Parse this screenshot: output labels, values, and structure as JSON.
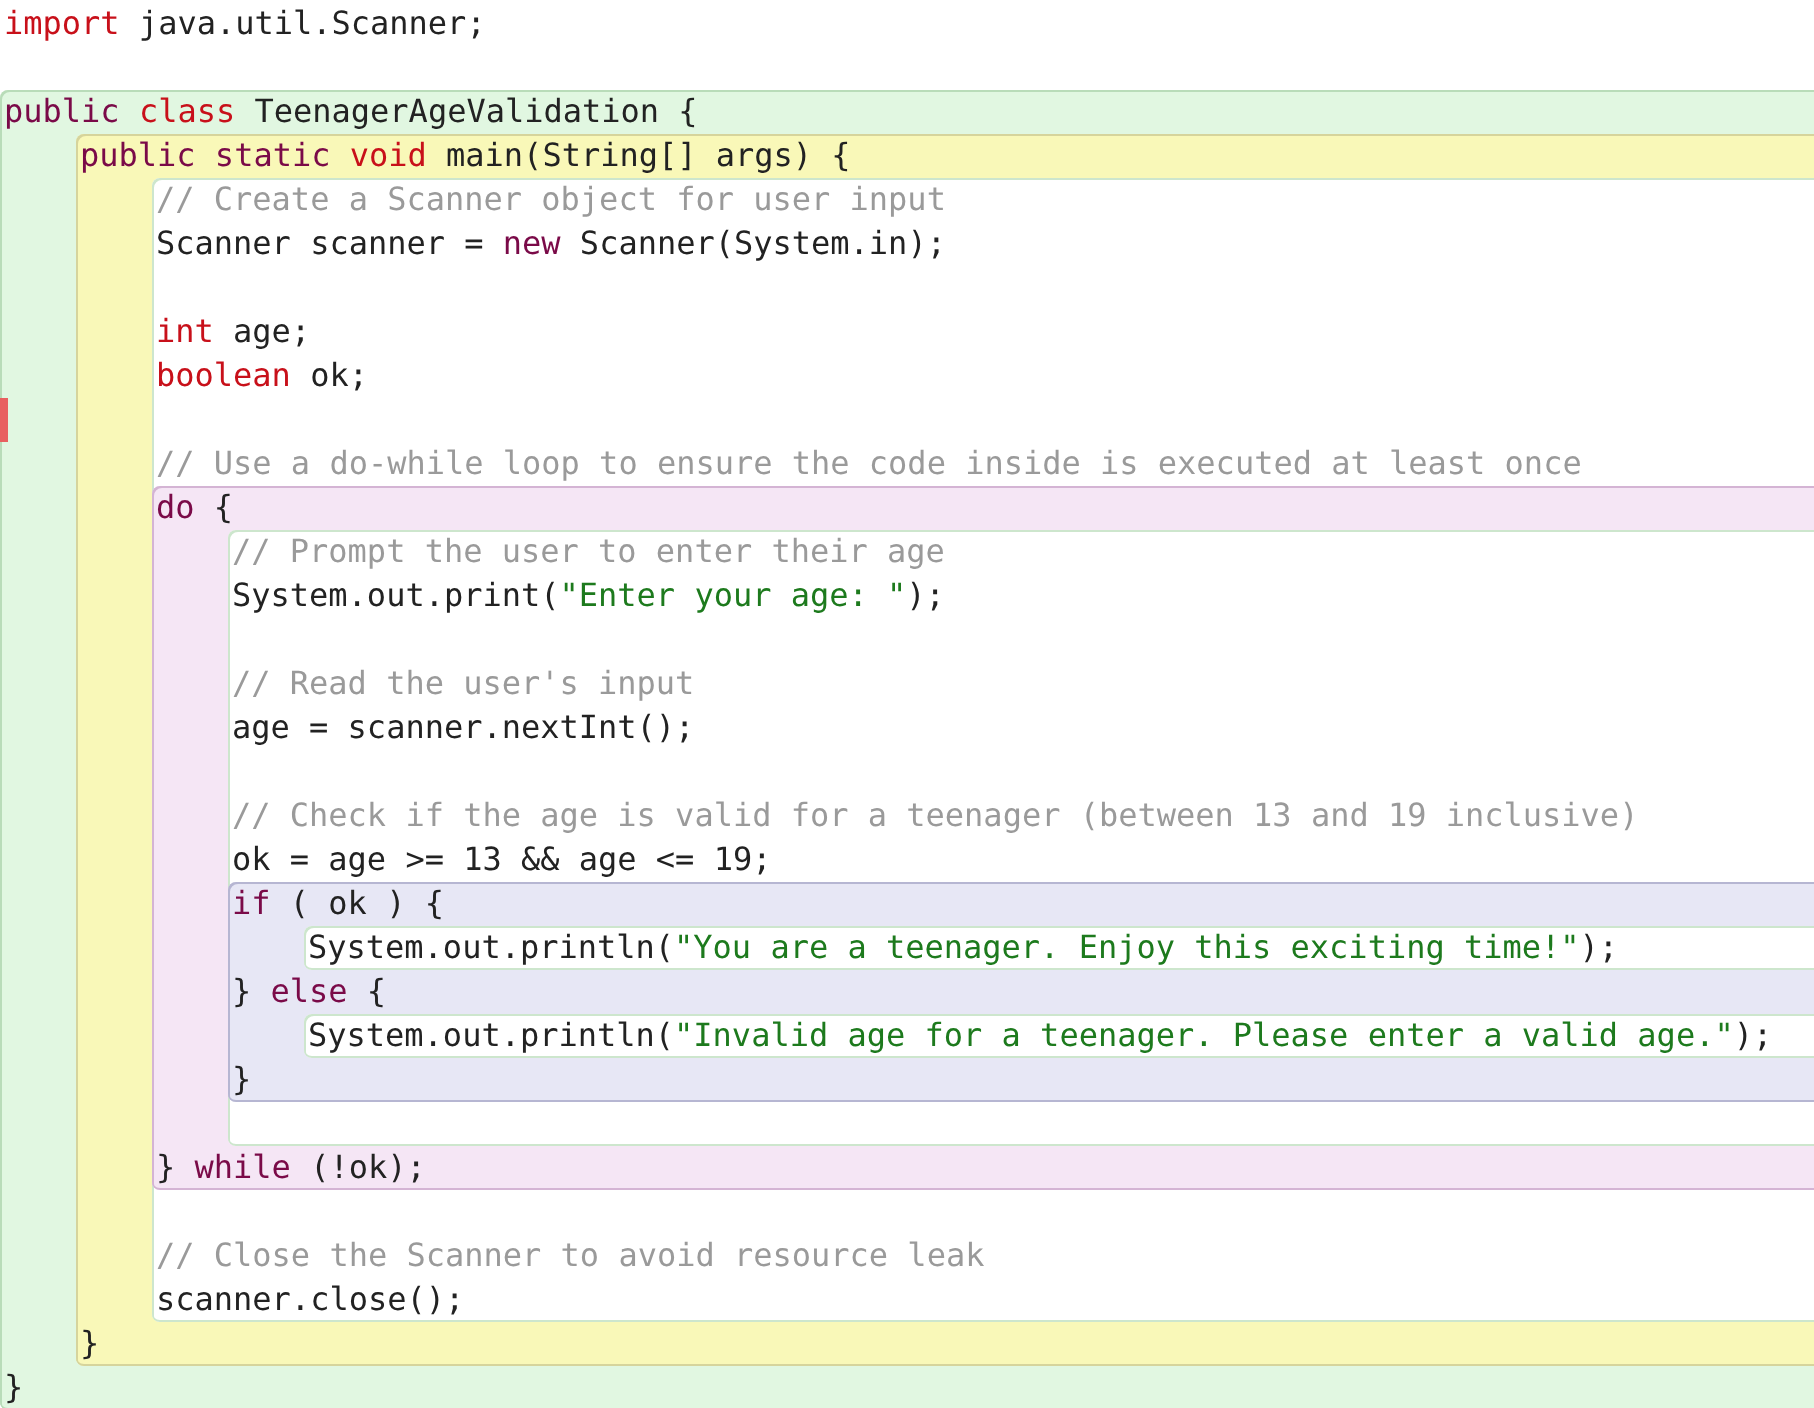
{
  "editor": {
    "items": [
      {
        "kind": "line",
        "tokens": [
          {
            "kind": "type",
            "text": "import"
          },
          {
            "kind": "plain",
            "text": " java.util.Scanner;"
          }
        ]
      },
      {
        "kind": "blank"
      },
      {
        "kind": "class",
        "items": [
          {
            "kind": "line",
            "tokens": [
              {
                "kind": "kw",
                "text": "public "
              },
              {
                "kind": "type",
                "text": "class"
              },
              {
                "kind": "plain",
                "text": " TeenagerAgeValidation {"
              }
            ]
          },
          {
            "kind": "method",
            "items": [
              {
                "kind": "line",
                "tokens": [
                  {
                    "kind": "kw",
                    "text": "public static "
                  },
                  {
                    "kind": "type",
                    "text": "void"
                  },
                  {
                    "kind": "plain",
                    "text": " main(String[] args) {"
                  }
                ]
              },
              {
                "kind": "body",
                "items": [
                  {
                    "kind": "line",
                    "tokens": [
                      {
                        "kind": "comment",
                        "text": "// Create a Scanner object for user input"
                      }
                    ]
                  },
                  {
                    "kind": "line",
                    "tokens": [
                      {
                        "kind": "plain",
                        "text": "Scanner scanner = "
                      },
                      {
                        "kind": "kw",
                        "text": "new"
                      },
                      {
                        "kind": "plain",
                        "text": " Scanner(System.in);"
                      }
                    ]
                  },
                  {
                    "kind": "blank"
                  },
                  {
                    "kind": "line",
                    "tokens": [
                      {
                        "kind": "type",
                        "text": "int"
                      },
                      {
                        "kind": "plain",
                        "text": " age;"
                      }
                    ]
                  },
                  {
                    "kind": "line",
                    "tokens": [
                      {
                        "kind": "type",
                        "text": "boolean"
                      },
                      {
                        "kind": "plain",
                        "text": " ok;"
                      }
                    ]
                  },
                  {
                    "kind": "marked_blank"
                  },
                  {
                    "kind": "line",
                    "tokens": [
                      {
                        "kind": "comment",
                        "text": "// Use a do-while loop to ensure the code inside is executed at least once"
                      }
                    ]
                  },
                  {
                    "kind": "loop",
                    "items": [
                      {
                        "kind": "line",
                        "tokens": [
                          {
                            "kind": "kw",
                            "text": "do"
                          },
                          {
                            "kind": "plain",
                            "text": " {"
                          }
                        ]
                      },
                      {
                        "kind": "body",
                        "items": [
                          {
                            "kind": "line",
                            "tokens": [
                              {
                                "kind": "comment",
                                "text": "// Prompt the user to enter their age"
                              }
                            ]
                          },
                          {
                            "kind": "line",
                            "tokens": [
                              {
                                "kind": "plain",
                                "text": "System.out.print("
                              },
                              {
                                "kind": "string",
                                "text": "\"Enter your age: \""
                              },
                              {
                                "kind": "plain",
                                "text": ");"
                              }
                            ]
                          },
                          {
                            "kind": "blank"
                          },
                          {
                            "kind": "line",
                            "tokens": [
                              {
                                "kind": "comment",
                                "text": "// Read the user's input"
                              }
                            ]
                          },
                          {
                            "kind": "line",
                            "tokens": [
                              {
                                "kind": "plain",
                                "text": "age = scanner.nextInt();"
                              }
                            ]
                          },
                          {
                            "kind": "blank"
                          },
                          {
                            "kind": "line",
                            "tokens": [
                              {
                                "kind": "comment",
                                "text": "// Check if the age is valid for a teenager (between 13 and 19 inclusive)"
                              }
                            ]
                          },
                          {
                            "kind": "line",
                            "tokens": [
                              {
                                "kind": "plain",
                                "text": "ok = age >= 13 && age <= 19;"
                              }
                            ]
                          },
                          {
                            "kind": "if",
                            "items": [
                              {
                                "kind": "line",
                                "tokens": [
                                  {
                                    "kind": "kw",
                                    "text": "if"
                                  },
                                  {
                                    "kind": "plain",
                                    "text": " ( ok ) {"
                                  }
                                ]
                              },
                              {
                                "kind": "body",
                                "items": [
                                  {
                                    "kind": "line",
                                    "tokens": [
                                      {
                                        "kind": "plain",
                                        "text": "System.out.println("
                                      },
                                      {
                                        "kind": "string",
                                        "text": "\"You are a teenager. Enjoy this exciting time!\""
                                      },
                                      {
                                        "kind": "plain",
                                        "text": ");"
                                      }
                                    ]
                                  }
                                ]
                              },
                              {
                                "kind": "line",
                                "tokens": [
                                  {
                                    "kind": "plain",
                                    "text": "} "
                                  },
                                  {
                                    "kind": "kw",
                                    "text": "else"
                                  },
                                  {
                                    "kind": "plain",
                                    "text": " {"
                                  }
                                ]
                              },
                              {
                                "kind": "body",
                                "items": [
                                  {
                                    "kind": "line",
                                    "tokens": [
                                      {
                                        "kind": "plain",
                                        "text": "System.out.println("
                                      },
                                      {
                                        "kind": "string",
                                        "text": "\"Invalid age for a teenager. Please enter a valid age.\""
                                      },
                                      {
                                        "kind": "plain",
                                        "text": ");"
                                      }
                                    ]
                                  }
                                ]
                              },
                              {
                                "kind": "line",
                                "tokens": [
                                  {
                                    "kind": "plain",
                                    "text": "}"
                                  }
                                ]
                              }
                            ]
                          },
                          {
                            "kind": "blank"
                          }
                        ]
                      },
                      {
                        "kind": "line",
                        "tokens": [
                          {
                            "kind": "plain",
                            "text": "} "
                          },
                          {
                            "kind": "kw",
                            "text": "while"
                          },
                          {
                            "kind": "plain",
                            "text": " (!ok);"
                          }
                        ]
                      }
                    ]
                  },
                  {
                    "kind": "blank"
                  },
                  {
                    "kind": "line",
                    "tokens": [
                      {
                        "kind": "comment",
                        "text": "// Close the Scanner to avoid resource leak"
                      }
                    ]
                  },
                  {
                    "kind": "line",
                    "tokens": [
                      {
                        "kind": "plain",
                        "text": "scanner.close();"
                      }
                    ]
                  }
                ]
              },
              {
                "kind": "line",
                "tokens": [
                  {
                    "kind": "plain",
                    "text": "}"
                  }
                ]
              }
            ]
          },
          {
            "kind": "line",
            "tokens": [
              {
                "kind": "plain",
                "text": "}"
              }
            ]
          }
        ]
      }
    ]
  }
}
